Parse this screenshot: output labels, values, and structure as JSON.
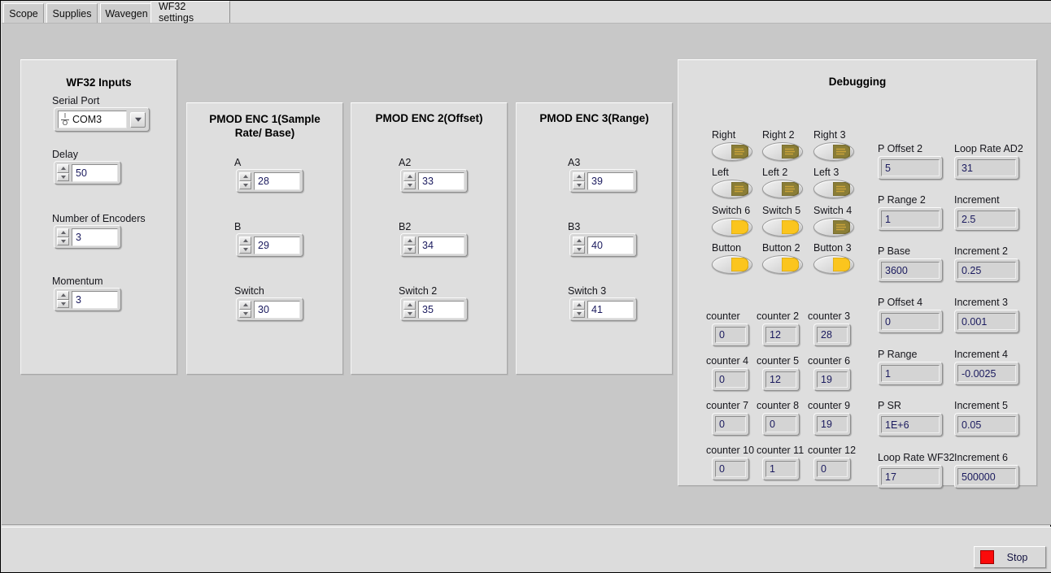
{
  "tabs": [
    {
      "label": "Scope",
      "active": false
    },
    {
      "label": "Supplies",
      "active": false
    },
    {
      "label": "Wavegen",
      "active": false
    },
    {
      "label": "WF32 settings",
      "active": true
    }
  ],
  "wf32_inputs": {
    "title": "WF32 Inputs",
    "serial_port": {
      "label": "Serial Port",
      "value": "COM3",
      "icon": "visa-io-icon",
      "dropdown_icon": "chevron-down-icon"
    },
    "fields": [
      {
        "label": "Delay",
        "value": "50"
      },
      {
        "label": "Number of Encoders",
        "value": "3"
      },
      {
        "label": "Momentum",
        "value": "3"
      }
    ]
  },
  "pmod_enc_1": {
    "title": "PMOD ENC 1(Sample Rate/ Base)",
    "fields": [
      {
        "label": "A",
        "value": "28"
      },
      {
        "label": "B",
        "value": "29"
      },
      {
        "label": "Switch",
        "value": "30"
      }
    ]
  },
  "pmod_enc_2": {
    "title": "PMOD ENC 2(Offset)",
    "fields": [
      {
        "label": "A2",
        "value": "33"
      },
      {
        "label": "B2",
        "value": "34"
      },
      {
        "label": "Switch 2",
        "value": "35"
      }
    ]
  },
  "pmod_enc_3": {
    "title": "PMOD ENC 3(Range)",
    "fields": [
      {
        "label": "A3",
        "value": "39"
      },
      {
        "label": "B3",
        "value": "40"
      },
      {
        "label": "Switch 3",
        "value": "41"
      }
    ]
  },
  "debugging": {
    "title": "Debugging",
    "booleans": [
      {
        "label": "Right",
        "state": "off"
      },
      {
        "label": "Right 2",
        "state": "off"
      },
      {
        "label": "Right 3",
        "state": "off"
      },
      {
        "label": "Left",
        "state": "off"
      },
      {
        "label": "Left 2",
        "state": "off"
      },
      {
        "label": "Left 3",
        "state": "off"
      },
      {
        "label": "Switch 6",
        "state": "on"
      },
      {
        "label": "Switch 5",
        "state": "on"
      },
      {
        "label": "Switch 4",
        "state": "off"
      },
      {
        "label": "Button",
        "state": "on"
      },
      {
        "label": "Button 2",
        "state": "on"
      },
      {
        "label": "Button 3",
        "state": "on"
      }
    ],
    "counters": [
      {
        "label": "counter",
        "value": "0"
      },
      {
        "label": "counter 2",
        "value": "12"
      },
      {
        "label": "counter 3",
        "value": "28"
      },
      {
        "label": "counter 4",
        "value": "0"
      },
      {
        "label": "counter 5",
        "value": "12"
      },
      {
        "label": "counter 6",
        "value": "19"
      },
      {
        "label": "counter 7",
        "value": "0"
      },
      {
        "label": "counter 8",
        "value": "0"
      },
      {
        "label": "counter 9",
        "value": "19"
      },
      {
        "label": "counter 10",
        "value": "0"
      },
      {
        "label": "counter 11",
        "value": "1"
      },
      {
        "label": "counter 12",
        "value": "0"
      }
    ],
    "params_col1": [
      {
        "label": "P Offset 2",
        "value": "5"
      },
      {
        "label": "P Range 2",
        "value": "1"
      },
      {
        "label": "P Base",
        "value": "3600"
      },
      {
        "label": "P Offset 4",
        "value": "0"
      },
      {
        "label": "P Range",
        "value": "1"
      },
      {
        "label": "P SR",
        "value": "1E+6"
      },
      {
        "label": "Loop Rate WF32",
        "value": "17"
      }
    ],
    "params_col2": [
      {
        "label": "Loop Rate AD2",
        "value": "31"
      },
      {
        "label": "Increment",
        "value": "2.5"
      },
      {
        "label": "Increment 2",
        "value": "0.25"
      },
      {
        "label": "Increment 3",
        "value": "0.001"
      },
      {
        "label": "Increment 4",
        "value": "-0.0025"
      },
      {
        "label": "Increment 5",
        "value": "0.05"
      },
      {
        "label": "Increment 6",
        "value": "500000"
      }
    ]
  },
  "stop_button": {
    "label": "Stop",
    "led_icon": "stop-square-icon",
    "led_color": "#fb0b0b"
  },
  "colors": {
    "window_bg": "#dcdcdc",
    "canvas_bg": "#c8c8c8",
    "panel_bg": "#dedede",
    "led_on": "#fbc51e",
    "led_off": "#8a7d36",
    "value_text": "#1a1a5e"
  }
}
